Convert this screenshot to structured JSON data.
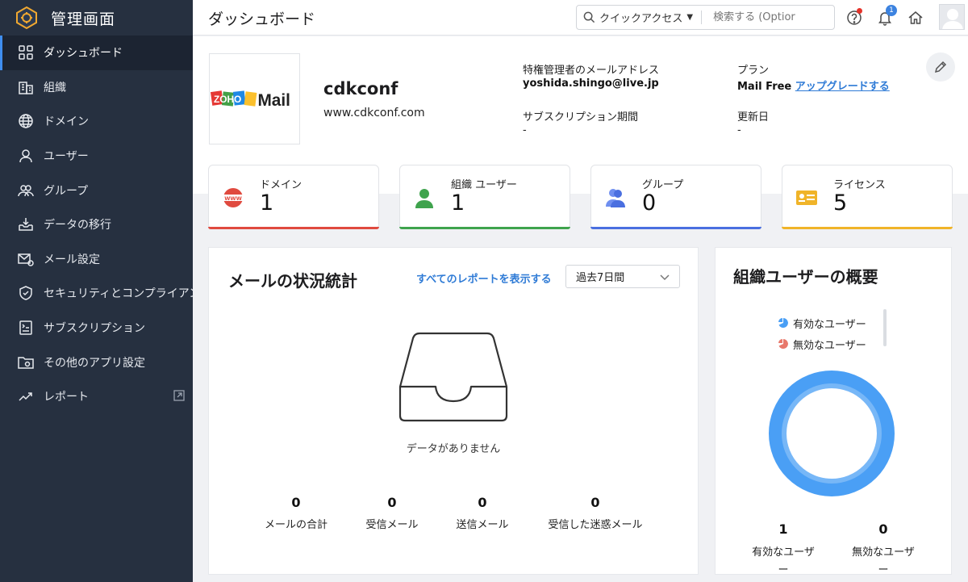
{
  "sidebar": {
    "title": "管理画面",
    "items": [
      {
        "label": "ダッシュボード"
      },
      {
        "label": "組織"
      },
      {
        "label": "ドメイン"
      },
      {
        "label": "ユーザー"
      },
      {
        "label": "グループ"
      },
      {
        "label": "データの移行"
      },
      {
        "label": "メール設定"
      },
      {
        "label": "セキュリティとコンプライアンス"
      },
      {
        "label": "サブスクリプション"
      },
      {
        "label": "その他のアプリ設定"
      },
      {
        "label": "レポート"
      }
    ]
  },
  "topbar": {
    "title": "ダッシュボード",
    "quick_access": "クイックアクセス",
    "search_placeholder": "検索する (Optior",
    "notification_count": "1"
  },
  "org": {
    "name": "cdkconf",
    "url": "www.cdkconf.com",
    "logo_text_zoho": "ZOHO",
    "logo_text_mail": "Mail",
    "admin_email_label": "特権管理者のメールアドレス",
    "admin_email": "yoshida.shingo@live.jp",
    "plan_label": "プラン",
    "plan_value": "Mail Free",
    "upgrade_label": "アップグレードする",
    "subscription_label": "サブスクリプション期間",
    "subscription_value": "-",
    "renewal_label": "更新日",
    "renewal_value": "-"
  },
  "stats": [
    {
      "label": "ドメイン",
      "value": "1",
      "color": "#e04a3f"
    },
    {
      "label": "組織 ユーザー",
      "value": "1",
      "color": "#3fa34d"
    },
    {
      "label": "グループ",
      "value": "0",
      "color": "#4a6fe0"
    },
    {
      "label": "ライセンス",
      "value": "5",
      "color": "#f0b429"
    }
  ],
  "mail_stats": {
    "title": "メールの状況統計",
    "report_link": "すべてのレポートを表示する",
    "period": "過去7日間",
    "empty_text": "データがありません",
    "items": [
      {
        "value": "0",
        "label": "メールの合計"
      },
      {
        "value": "0",
        "label": "受信メール"
      },
      {
        "value": "0",
        "label": "送信メール"
      },
      {
        "value": "0",
        "label": "受信した迷惑メール"
      }
    ]
  },
  "users_overview": {
    "title": "組織ユーザーの概要",
    "legend": [
      {
        "label": "有効なユーザー",
        "color": "#4a9ff5"
      },
      {
        "label": "無効なユーザー",
        "color": "#e8786b"
      }
    ],
    "chart_data": {
      "type": "pie",
      "categories": [
        "有効なユーザー",
        "無効なユーザー"
      ],
      "values": [
        1,
        0
      ]
    },
    "active_value": "1",
    "active_label": "有効なユーザー",
    "inactive_value": "0",
    "inactive_label": "無効なユーザー"
  }
}
